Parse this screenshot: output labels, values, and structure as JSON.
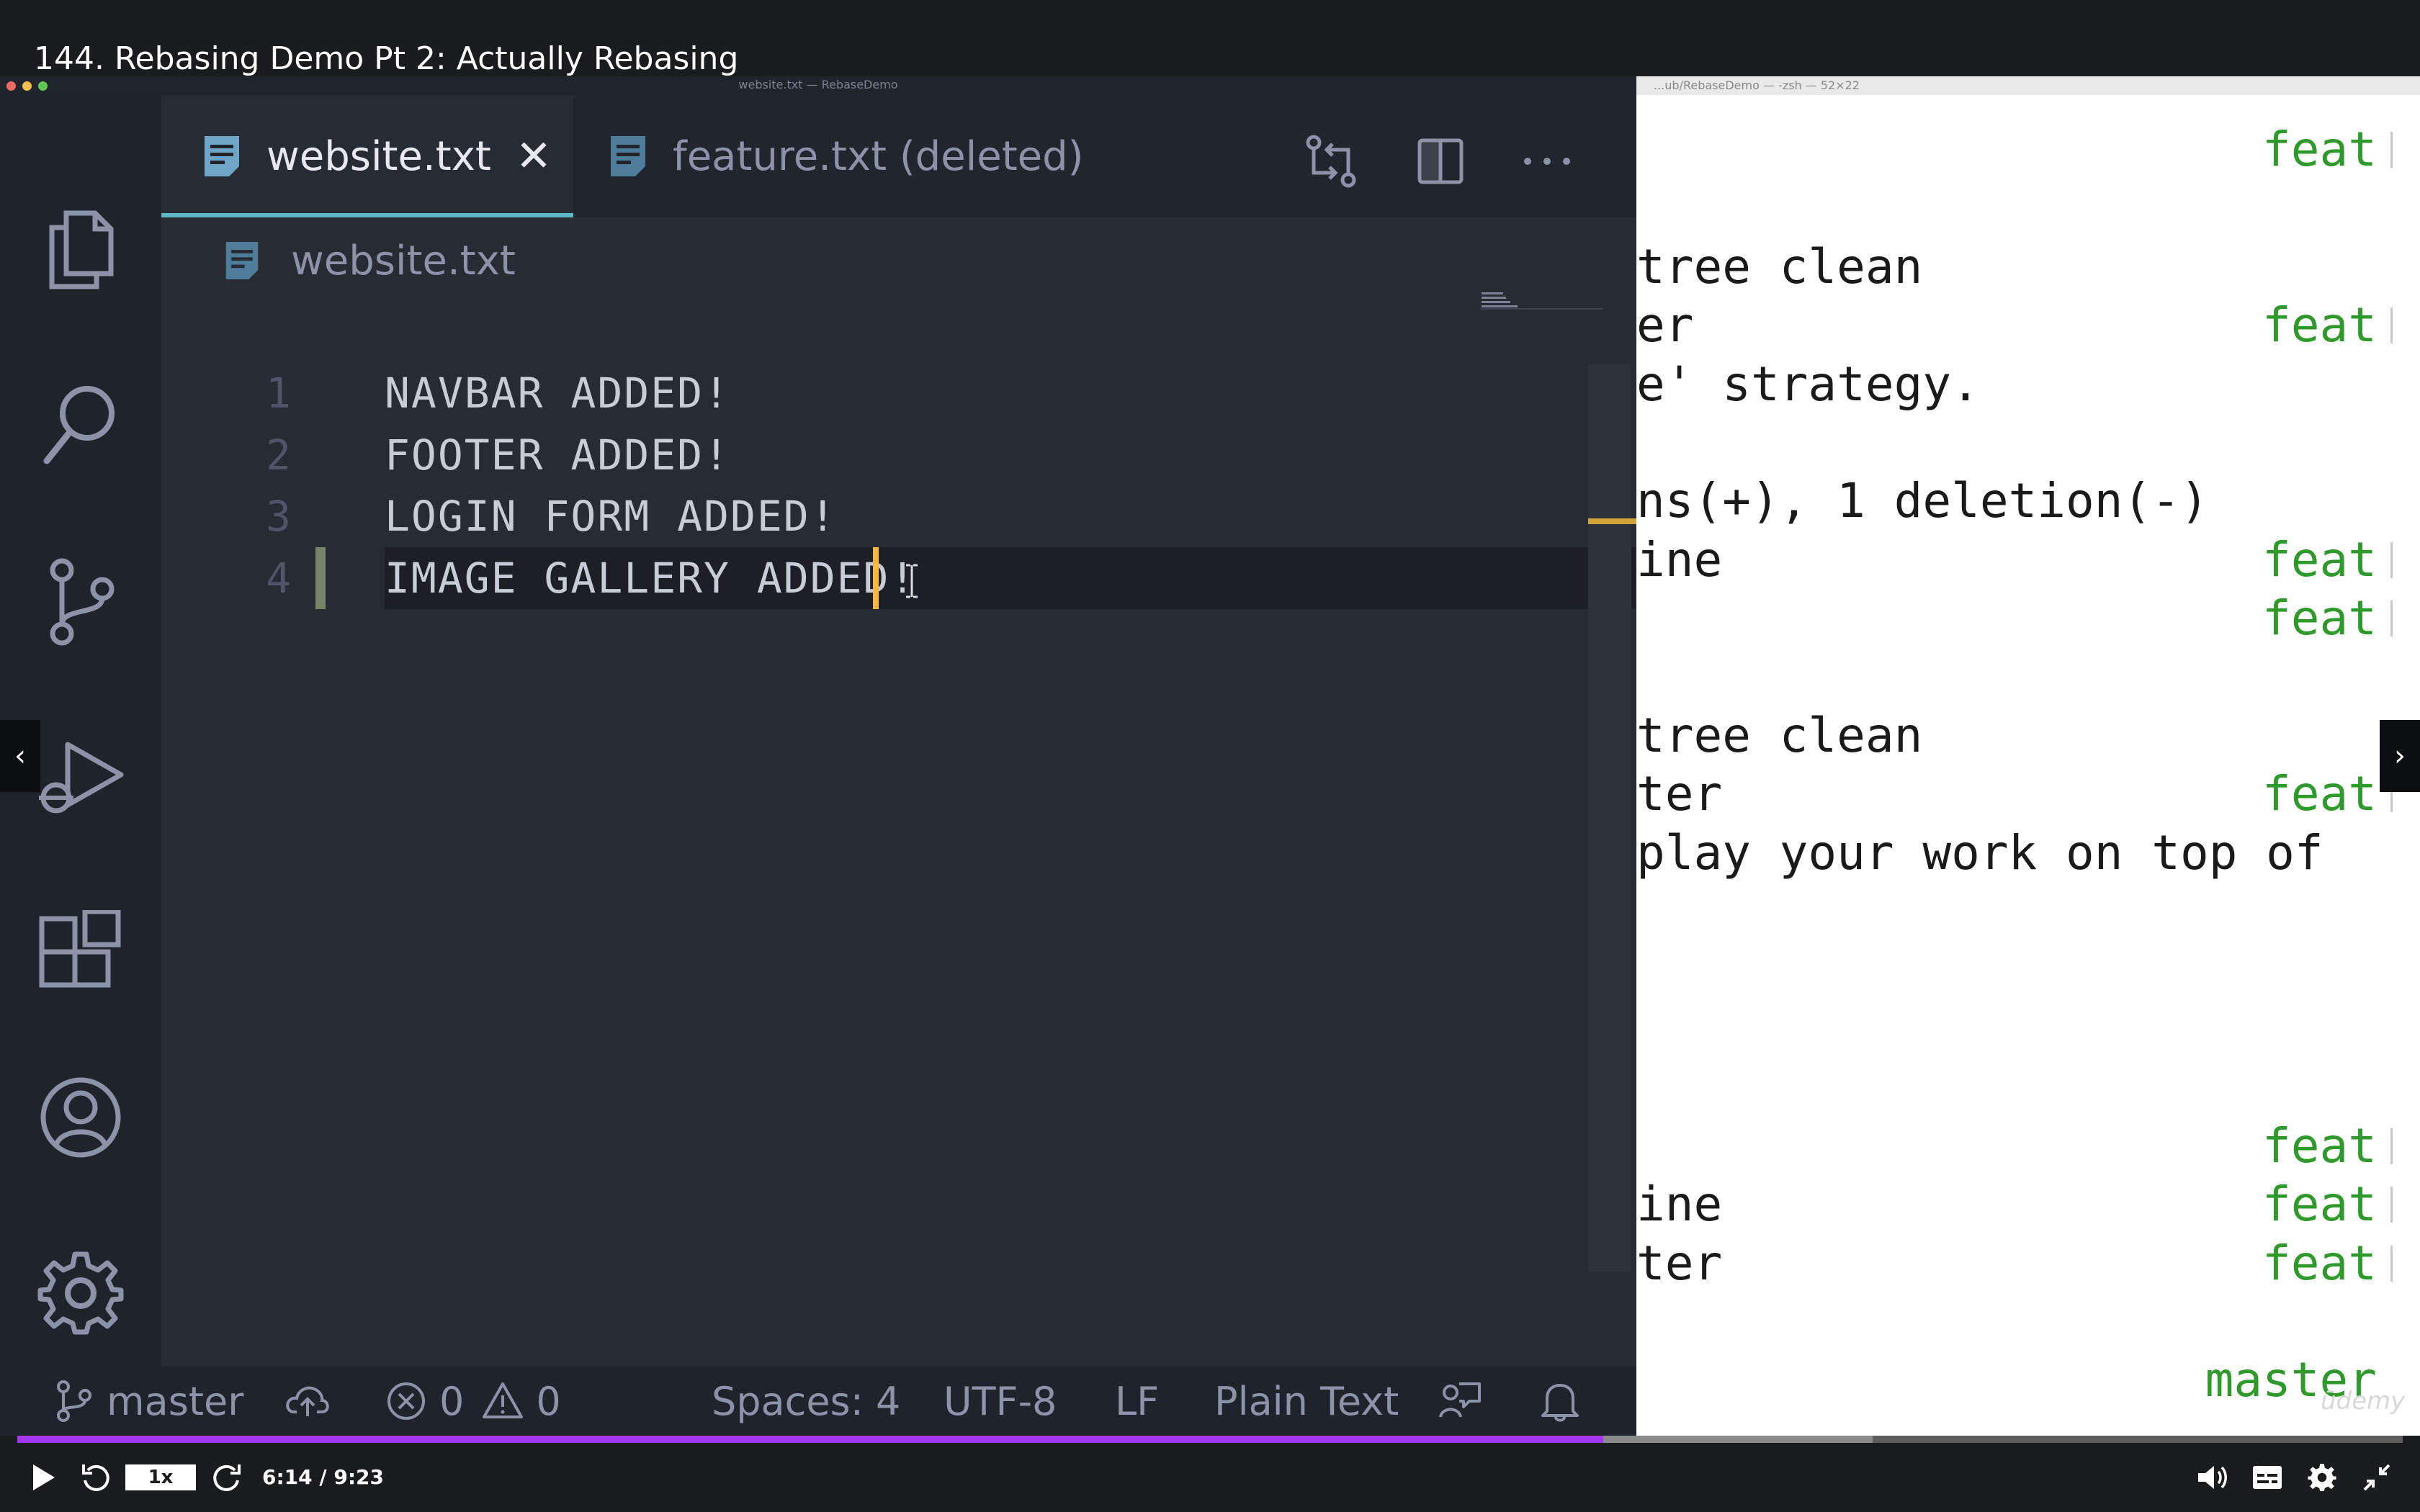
{
  "video": {
    "title": "144. Rebasing Demo Pt 2: Actually Rebasing"
  },
  "vscode": {
    "window_title": "website.txt — RebaseDemo",
    "tabs": [
      {
        "label": "website.txt",
        "active": true
      },
      {
        "label": "feature.txt (deleted)",
        "active": false
      }
    ],
    "breadcrumb": "website.txt",
    "lines": [
      {
        "number": "1",
        "text": "NAVBAR ADDED!"
      },
      {
        "number": "2",
        "text": "FOOTER ADDED!"
      },
      {
        "number": "3",
        "text": "LOGIN FORM ADDED!"
      },
      {
        "number": "4",
        "text": "IMAGE GALLERY ADDED!"
      }
    ],
    "activity_icons": [
      "files-icon",
      "search-icon",
      "source-control-icon",
      "run-debug-icon",
      "extensions-icon",
      "account-icon",
      "settings-gear-icon"
    ],
    "status": {
      "branch": "master",
      "errors": "0",
      "warnings": "0",
      "spaces": "Spaces: 4",
      "encoding": "UTF-8",
      "eol": "LF",
      "language": "Plain Text"
    },
    "colors": {
      "accent_tab_underline": "#5fb8c3",
      "cursor": "#f5b842",
      "editor_bg": "#262b34"
    }
  },
  "terminal": {
    "title": "...ub/RebaseDemo — -zsh — 52×22",
    "lines": [
      {
        "left": "",
        "right": "feat"
      },
      {
        "left": "",
        "right": ""
      },
      {
        "left": "tree clean",
        "right": ""
      },
      {
        "left": "er",
        "right": "feat"
      },
      {
        "left": "e' strategy.",
        "right": ""
      },
      {
        "left": "",
        "right": ""
      },
      {
        "left": "ns(+), 1 deletion(-)",
        "right": ""
      },
      {
        "left": "ine",
        "right": "feat"
      },
      {
        "left": "",
        "right": "feat"
      },
      {
        "left": "",
        "right": ""
      },
      {
        "left": "tree clean",
        "right": ""
      },
      {
        "left": "ter",
        "right": "feat"
      },
      {
        "left": "play your work on top of",
        "right": ""
      },
      {
        "left": "",
        "right": ""
      },
      {
        "left": "",
        "right": ""
      },
      {
        "left": "",
        "right": ""
      },
      {
        "left": "",
        "right": ""
      },
      {
        "left": "",
        "right": "feat"
      },
      {
        "left": "ine",
        "right": "feat"
      },
      {
        "left": "ter",
        "right": "feat"
      },
      {
        "left": "",
        "right": ""
      },
      {
        "left": "",
        "right": "master"
      }
    ],
    "watermark": "ūdemy"
  },
  "player": {
    "speed": "1x",
    "time": "6:14 / 9:23",
    "progress": 0.665
  }
}
